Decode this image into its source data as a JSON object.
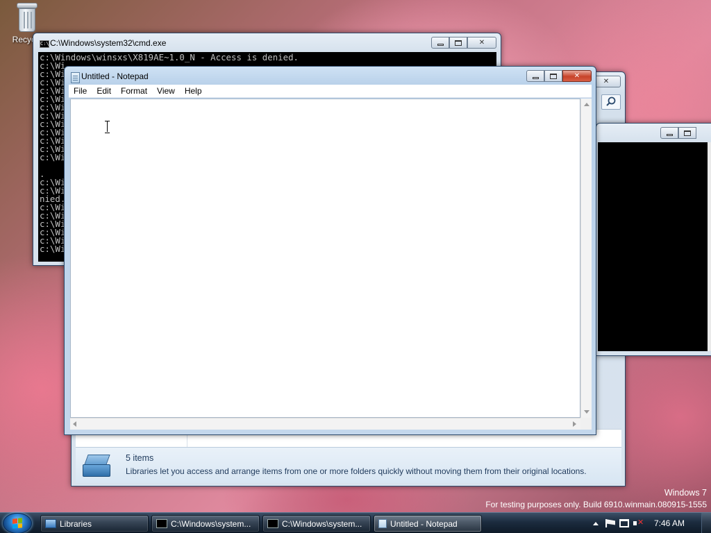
{
  "desktop": {
    "recycle_bin_label": "Recycle"
  },
  "cmd_window": {
    "title": "C:\\Windows\\system32\\cmd.exe",
    "lines": [
      "c:\\Windows\\winsxs\\X819AE~1.0_N - Access is denied.",
      "c:\\Wi",
      "c:\\Wi",
      "c:\\Wi",
      "c:\\Wi",
      "c:\\Wi",
      "c:\\Wi",
      "c:\\Wi",
      "c:\\Wi",
      "c:\\Wi",
      "c:\\Wi",
      "c:\\Wi",
      "c:\\Wi",
      "",
      ".",
      "c:\\Wi",
      "c:\\Wi",
      "nied.",
      "c:\\Wi",
      "c:\\Wi",
      "c:\\Wi",
      "c:\\Wi",
      "c:\\Wi",
      "c:\\Wi",
      "",
      "C:\\Us"
    ]
  },
  "explorer_window": {
    "item_count": "5 items",
    "description": "Libraries let you access and arrange items from one or more folders quickly without moving them from their original locations."
  },
  "notepad": {
    "title": "Untitled - Notepad",
    "menu": [
      "File",
      "Edit",
      "Format",
      "View",
      "Help"
    ],
    "content": ""
  },
  "watermark": {
    "line1": "Windows 7",
    "line2": "For testing purposes only. Build 6910.winmain.080915-1555"
  },
  "taskbar": {
    "buttons": [
      {
        "label": "Libraries",
        "icon": "libraries-icon"
      },
      {
        "label": "C:\\Windows\\system...",
        "icon": "cmd-icon"
      },
      {
        "label": "C:\\Windows\\system...",
        "icon": "cmd-icon"
      },
      {
        "label": "Untitled - Notepad",
        "icon": "notepad-icon"
      }
    ],
    "clock": "7:46 AM"
  }
}
